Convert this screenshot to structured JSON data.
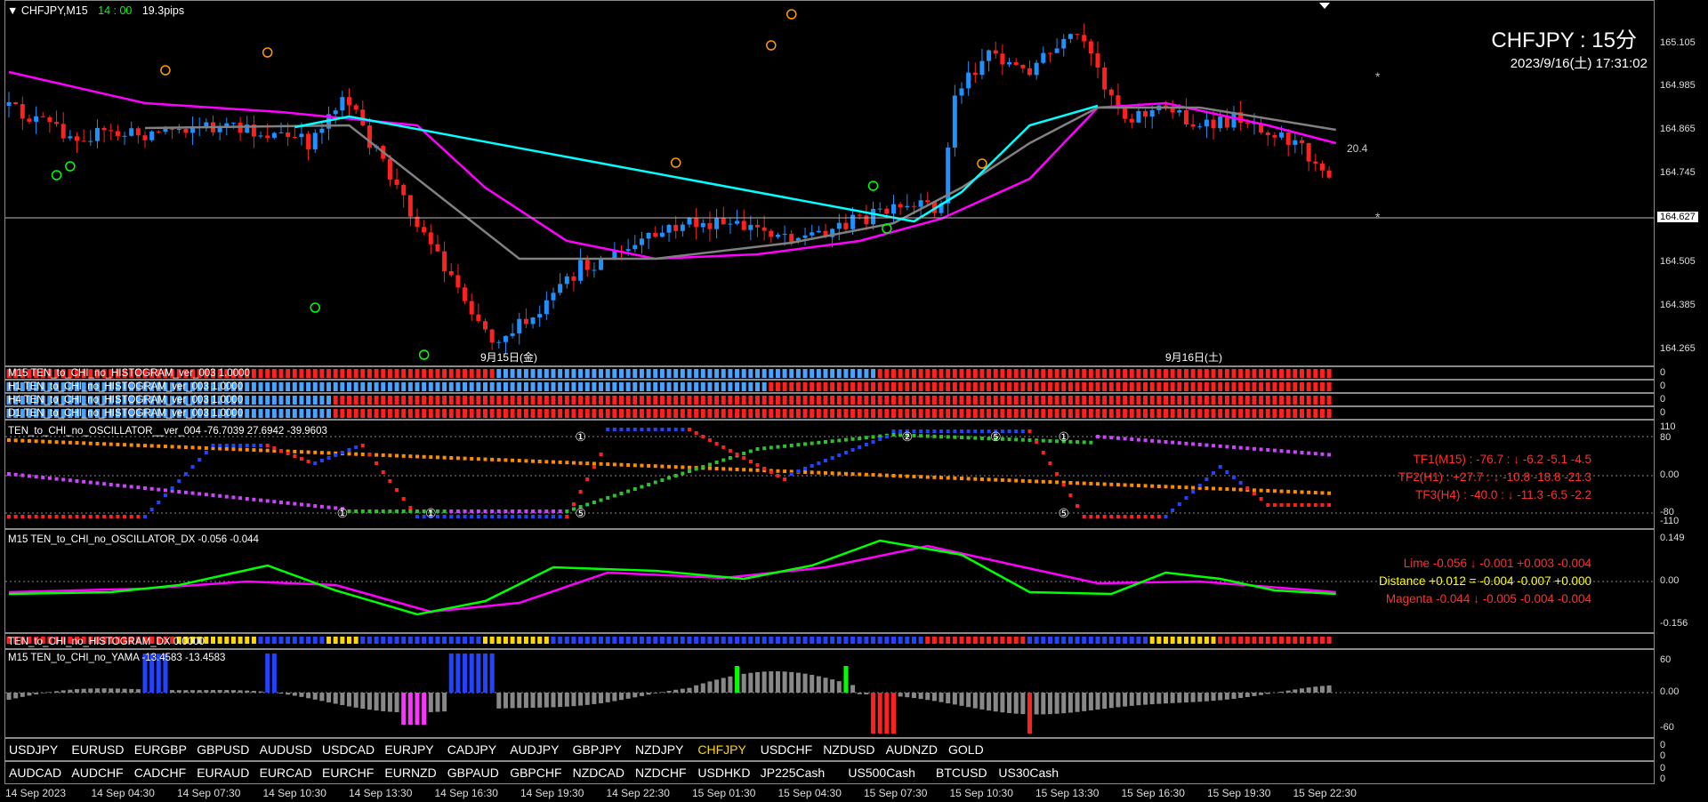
{
  "header": {
    "symbol_tf": "CHFJPY,M15",
    "time_hm": "14 : 00",
    "pips": "19.3pips"
  },
  "info": {
    "big_title": "CHFJPY : 15分",
    "datetime": "2023/9/16(土) 17:31:02",
    "distance_label": "20.4",
    "current_price": "164.627"
  },
  "price_axis": [
    "165.105",
    "164.985",
    "164.865",
    "164.745",
    "164.505",
    "164.385",
    "164.265"
  ],
  "date_markers": [
    "9月15日(金)",
    "9月16日(土)"
  ],
  "histogram_panels": [
    {
      "label": "M15 TEN_to_CHI_no_HISTOGRAM_ver_003 1.0000",
      "scale": "0"
    },
    {
      "label": "H1 TEN_to_CHI_no_HISTOGRAM_ver_003 1.0000",
      "scale": "0"
    },
    {
      "label": "H4 TEN_to_CHI_no_HISTOGRAM_ver_003 1.0000",
      "scale": "0"
    },
    {
      "label": "D1 TEN_to_CHI_no_HISTOGRAM_ver_003 1.0000",
      "scale": "0"
    }
  ],
  "oscillator": {
    "label": "TEN_to_CHI_no_OSCILLATOR__ver_004 -76.7039 27.6942 -39.9603",
    "scale": [
      "110",
      "80",
      "0.00",
      "-80",
      "-110"
    ],
    "tf1": "TF1(M15) : -76.7 : ↓ -6.2 -5.1 -4.5",
    "tf2": "TF2(H1) : +27.7 : ↓ -10.8 -18.8 -21.3",
    "tf3": "TF3(H4) : -40.0 : ↓ -11.3 -6.5 -2.2",
    "markers": [
      "①",
      "⑤",
      "①",
      "②",
      "⑤",
      "①",
      "⑤",
      "①"
    ]
  },
  "dx": {
    "label": "M15 TEN_to_CHI_no_OSCILLATOR_DX -0.056 -0.044",
    "scale": [
      "0.149",
      "0.00",
      "-0.156"
    ],
    "lime": "Lime -0.056 ↓ -0.001 +0.003 -0.004",
    "distance": "Distance +0.012 = -0.004 -0.007 +0.000",
    "magenta": "Magenta -0.044 ↓ -0.005 -0.004 -0.004"
  },
  "hist_dx": {
    "label": "TEN_to_CHI_no_HISTOGRAM_DX 0.0000"
  },
  "yama": {
    "label": "M15 TEN_to_CHI_no_YAMA -13.4583 -13.4583",
    "scale": [
      "60",
      "0.00",
      "-60"
    ]
  },
  "symbols_row1": [
    "USDJPY",
    "EURUSD",
    "EURGBP",
    "GBPUSD",
    "AUDUSD",
    "USDCAD",
    "EURJPY",
    "CADJPY",
    "AUDJPY",
    "GBPJPY",
    "NZDJPY",
    "CHFJPY",
    "USDCHF",
    "NZDUSD",
    "AUDNZD",
    "GOLD"
  ],
  "symbols_row2": [
    "AUDCAD",
    "AUDCHF",
    "CADCHF",
    "EURAUD",
    "EURCAD",
    "EURCHF",
    "EURNZD",
    "GBPAUD",
    "GBPCHF",
    "NZDCAD",
    "NZDCHF",
    "USDHKD",
    "JP225Cash",
    "US500Cash",
    "BTCUSD",
    "US30Cash"
  ],
  "active_symbol": "CHFJPY",
  "time_axis": [
    "14 Sep 2023",
    "14 Sep 04:30",
    "14 Sep 07:30",
    "14 Sep 10:30",
    "14 Sep 13:30",
    "14 Sep 16:30",
    "14 Sep 19:30",
    "14 Sep 22:30",
    "15 Sep 01:30",
    "15 Sep 04:30",
    "15 Sep 07:30",
    "15 Sep 10:30",
    "15 Sep 13:30",
    "15 Sep 16:30",
    "15 Sep 19:30",
    "15 Sep 22:30"
  ],
  "colors": {
    "bull": "#1e90ff",
    "bear": "#ff2020",
    "ma_magenta": "#ff00ff",
    "ma_cyan": "#00ffff",
    "ma_gray": "#808080",
    "lime": "#00ff00",
    "highlight": "#ffd700"
  }
}
